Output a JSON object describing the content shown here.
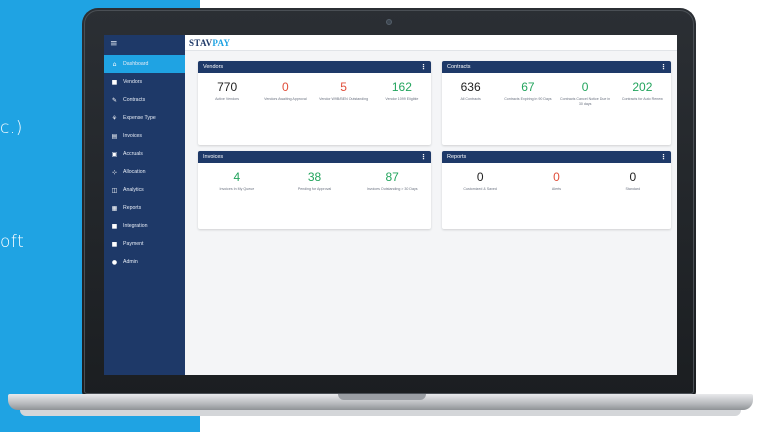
{
  "background_text": {
    "line1": "c.)",
    "line2": "oft"
  },
  "app": {
    "logo_part1": "STAV",
    "logo_part2": "PAY",
    "menu_icon": "≡"
  },
  "sidebar": {
    "items": [
      {
        "label": "Dashboard",
        "icon": "home-icon",
        "glyph": "⌂",
        "active": true
      },
      {
        "label": "Vendors",
        "icon": "vendor-icon",
        "glyph": "■"
      },
      {
        "label": "Contracts",
        "icon": "contract-icon",
        "glyph": "✎"
      },
      {
        "label": "Expense Type",
        "icon": "expense-icon",
        "glyph": "⚘"
      },
      {
        "label": "Invoices",
        "icon": "invoice-icon",
        "glyph": "▤"
      },
      {
        "label": "Accruals",
        "icon": "accrual-icon",
        "glyph": "▣"
      },
      {
        "label": "Allocation",
        "icon": "allocation-icon",
        "glyph": "⊹"
      },
      {
        "label": "Analytics",
        "icon": "analytics-icon",
        "glyph": "◫"
      },
      {
        "label": "Reports",
        "icon": "reports-icon",
        "glyph": "▦"
      },
      {
        "label": "Integration",
        "icon": "integration-icon",
        "glyph": "■"
      },
      {
        "label": "Payment",
        "icon": "payment-icon",
        "glyph": "■"
      },
      {
        "label": "Admin",
        "icon": "admin-icon",
        "glyph": "●"
      }
    ]
  },
  "cards": {
    "vendors": {
      "title": "Vendors",
      "menu": "⋮",
      "metrics": [
        {
          "value": "770",
          "label": "Active Vendors",
          "color": "black"
        },
        {
          "value": "0",
          "label": "Vendors Awaiting Approval",
          "color": "red"
        },
        {
          "value": "5",
          "label": "Vendor W9B/BEN Outstanding",
          "color": "red"
        },
        {
          "value": "162",
          "label": "Vendor 1099 Eligible",
          "color": "green"
        }
      ]
    },
    "contracts": {
      "title": "Contracts",
      "menu": "⋮",
      "metrics": [
        {
          "value": "636",
          "label": "All Contracts",
          "color": "black"
        },
        {
          "value": "67",
          "label": "Contracts Expiring in 90 Days",
          "color": "green"
        },
        {
          "value": "0",
          "label": "Contracts Cancel Notice Due in 30 days",
          "color": "green"
        },
        {
          "value": "202",
          "label": "Contracts for Auto Renew",
          "color": "green"
        }
      ]
    },
    "invoices": {
      "title": "Invoices",
      "menu": "⋮",
      "metrics": [
        {
          "value": "4",
          "label": "Invoices In My Queue",
          "color": "green"
        },
        {
          "value": "38",
          "label": "Pending for Approval",
          "color": "green"
        },
        {
          "value": "87",
          "label": "Invoices Outstanding > 30 Days",
          "color": "green"
        }
      ]
    },
    "reports": {
      "title": "Reports",
      "menu": "⋮",
      "metrics": [
        {
          "value": "0",
          "label": "Customized & Saved",
          "color": "black"
        },
        {
          "value": "0",
          "label": "Alerts",
          "color": "red"
        },
        {
          "value": "0",
          "label": "Standard",
          "color": "black"
        }
      ]
    }
  },
  "colors": {
    "brand_navy": "#1e3968",
    "accent_blue": "#1fa3e3",
    "red": "#e04e3a",
    "green": "#22a45d"
  }
}
